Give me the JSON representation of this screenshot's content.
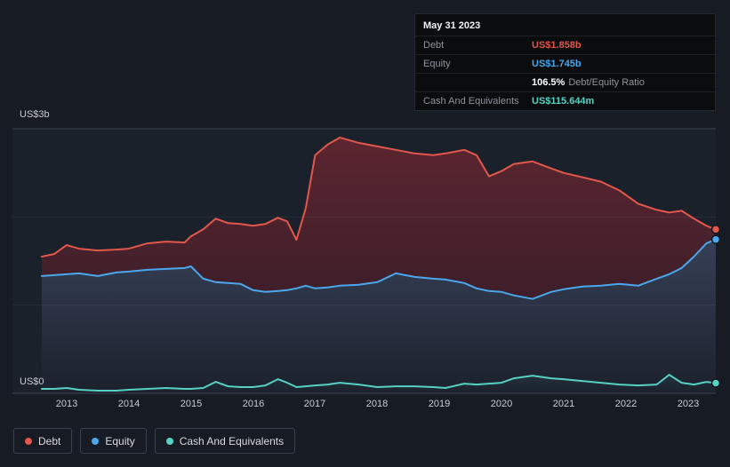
{
  "axis": {
    "y_top_label": "US$3b",
    "y_bottom_label": "US$0"
  },
  "tooltip": {
    "title": "May 31 2023",
    "debt_label": "Debt",
    "debt_value": "US$1.858b",
    "equity_label": "Equity",
    "equity_value": "US$1.745b",
    "ratio_percent": "106.5%",
    "ratio_label": "Debt/Equity Ratio",
    "cash_label": "Cash And Equivalents",
    "cash_value": "US$115.644m"
  },
  "legend": {
    "items": [
      {
        "label": "Debt",
        "color": "#e2574b"
      },
      {
        "label": "Equity",
        "color": "#4ba7ec"
      },
      {
        "label": "Cash And Equivalents",
        "color": "#56d1c3"
      }
    ]
  },
  "chart_data": {
    "type": "area",
    "unit": "US$ billions",
    "ylim": [
      0,
      3
    ],
    "xlim": [
      2012.6,
      2023.45
    ],
    "grid_values": [
      1,
      2
    ],
    "legend_position": "bottom-left",
    "x_tick_years": [
      2013,
      2014,
      2015,
      2016,
      2017,
      2018,
      2019,
      2020,
      2021,
      2022,
      2023
    ],
    "x_tick_labels": [
      "2013",
      "2014",
      "2015",
      "2016",
      "2017",
      "2018",
      "2019",
      "2020",
      "2021",
      "2022",
      "2023"
    ],
    "x": [
      2012.6,
      2012.8,
      2013.0,
      2013.2,
      2013.5,
      2013.8,
      2014.0,
      2014.3,
      2014.6,
      2014.9,
      2015.0,
      2015.2,
      2015.4,
      2015.6,
      2015.8,
      2016.0,
      2016.2,
      2016.4,
      2016.55,
      2016.7,
      2016.85,
      2017.0,
      2017.2,
      2017.4,
      2017.7,
      2018.0,
      2018.3,
      2018.6,
      2018.9,
      2019.1,
      2019.4,
      2019.6,
      2019.8,
      2020.0,
      2020.2,
      2020.5,
      2020.8,
      2021.0,
      2021.3,
      2021.6,
      2021.9,
      2022.2,
      2022.5,
      2022.7,
      2022.9,
      2023.1,
      2023.3,
      2023.45
    ],
    "series": [
      {
        "name": "Debt",
        "color": "#e2574b",
        "values": [
          1.55,
          1.58,
          1.68,
          1.64,
          1.62,
          1.63,
          1.64,
          1.7,
          1.72,
          1.71,
          1.78,
          1.86,
          1.98,
          1.93,
          1.92,
          1.9,
          1.92,
          1.99,
          1.95,
          1.74,
          2.1,
          2.7,
          2.82,
          2.9,
          2.84,
          2.8,
          2.76,
          2.72,
          2.7,
          2.72,
          2.76,
          2.7,
          2.46,
          2.52,
          2.6,
          2.63,
          2.55,
          2.5,
          2.45,
          2.4,
          2.3,
          2.15,
          2.08,
          2.05,
          2.07,
          1.98,
          1.9,
          1.858
        ]
      },
      {
        "name": "Equity",
        "color": "#4ba7ec",
        "values": [
          1.33,
          1.34,
          1.35,
          1.36,
          1.33,
          1.37,
          1.38,
          1.4,
          1.41,
          1.42,
          1.44,
          1.3,
          1.26,
          1.25,
          1.24,
          1.17,
          1.15,
          1.16,
          1.17,
          1.19,
          1.22,
          1.19,
          1.2,
          1.22,
          1.23,
          1.26,
          1.36,
          1.32,
          1.3,
          1.29,
          1.25,
          1.19,
          1.16,
          1.15,
          1.11,
          1.07,
          1.15,
          1.18,
          1.21,
          1.22,
          1.24,
          1.22,
          1.3,
          1.35,
          1.42,
          1.55,
          1.7,
          1.745
        ]
      },
      {
        "name": "Cash And Equivalents",
        "color": "#56d1c3",
        "values": [
          0.05,
          0.05,
          0.06,
          0.04,
          0.03,
          0.03,
          0.04,
          0.05,
          0.06,
          0.05,
          0.05,
          0.06,
          0.13,
          0.08,
          0.07,
          0.07,
          0.09,
          0.16,
          0.12,
          0.07,
          0.08,
          0.09,
          0.1,
          0.12,
          0.1,
          0.07,
          0.08,
          0.08,
          0.07,
          0.06,
          0.11,
          0.1,
          0.11,
          0.12,
          0.17,
          0.2,
          0.17,
          0.16,
          0.14,
          0.12,
          0.1,
          0.09,
          0.1,
          0.21,
          0.12,
          0.1,
          0.13,
          0.116
        ]
      }
    ]
  }
}
